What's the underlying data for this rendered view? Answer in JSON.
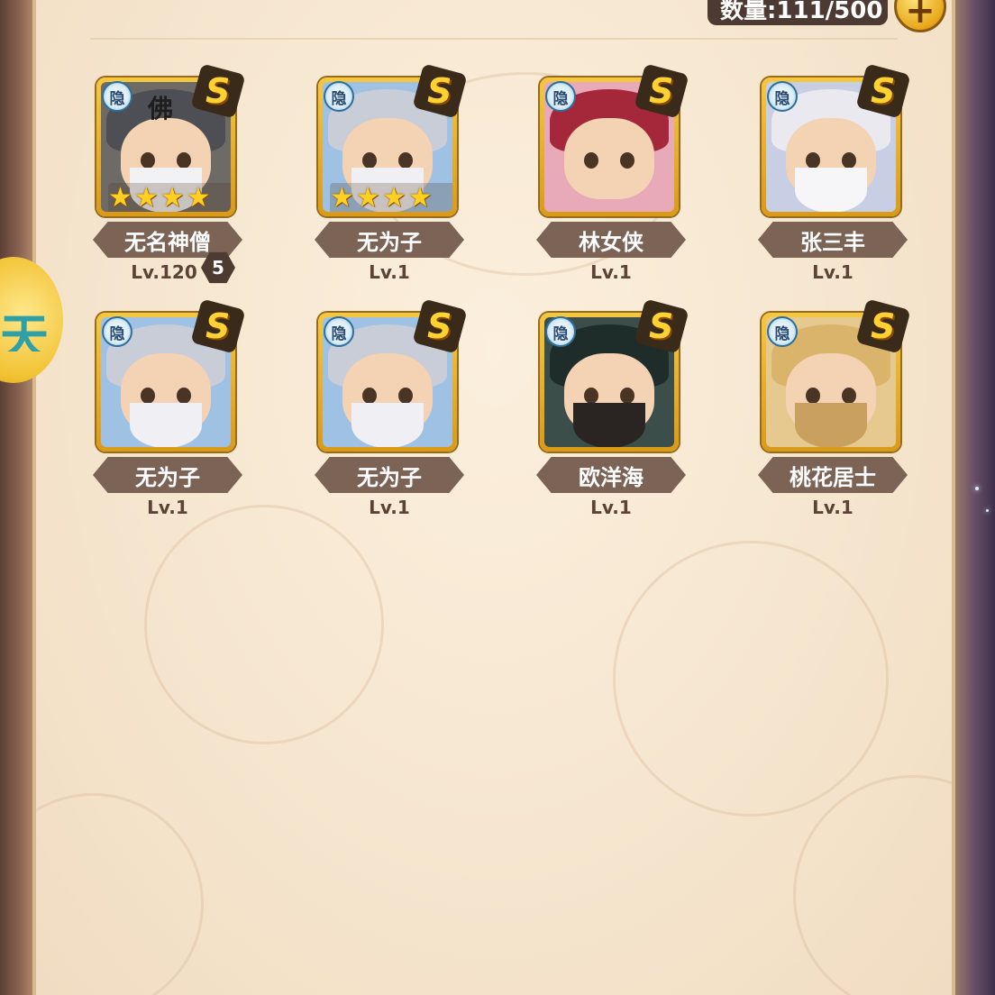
{
  "header": {
    "count_label": "数量:111/500",
    "add_label": "+"
  },
  "side_tab": {
    "glyph": "天"
  },
  "heroes": [
    {
      "name": "无名神僧",
      "level": "Lv.120",
      "stars": "★★★★",
      "rank": "S",
      "tag": "隐",
      "hat_text": "佛",
      "level_badge": "5",
      "colors": {
        "bg": "#6e6a66",
        "hair": "#4e4f55",
        "beard": "#f2f2f4"
      }
    },
    {
      "name": "无为子",
      "level": "Lv.1",
      "stars": "★★★★",
      "rank": "S",
      "tag": "隐",
      "colors": {
        "bg": "#9fc2e4",
        "hair": "#c9cdd8",
        "beard": "#f0f0f4"
      }
    },
    {
      "name": "林女侠",
      "level": "Lv.1",
      "rank": "S",
      "tag": "隐",
      "colors": {
        "bg": "#e8a9b8",
        "hair": "#a5283a",
        "beard": ""
      }
    },
    {
      "name": "张三丰",
      "level": "Lv.1",
      "rank": "S",
      "tag": "隐",
      "colors": {
        "bg": "#c8cfe4",
        "hair": "#e9e9ef",
        "beard": "#f6f6f8"
      }
    },
    {
      "name": "无为子",
      "level": "Lv.1",
      "rank": "S",
      "tag": "隐",
      "colors": {
        "bg": "#9fc2e4",
        "hair": "#c9cdd8",
        "beard": "#f0f0f4"
      }
    },
    {
      "name": "无为子",
      "level": "Lv.1",
      "rank": "S",
      "tag": "隐",
      "colors": {
        "bg": "#9fc2e4",
        "hair": "#c9cdd8",
        "beard": "#f0f0f4"
      }
    },
    {
      "name": "欧洋海",
      "level": "Lv.1",
      "rank": "S",
      "tag": "隐",
      "colors": {
        "bg": "#3c4e4a",
        "hair": "#1f2d2a",
        "beard": "#2a2522"
      }
    },
    {
      "name": "桃花居士",
      "level": "Lv.1",
      "rank": "S",
      "tag": "隐",
      "colors": {
        "bg": "#e6c98e",
        "hair": "#d9b46a",
        "beard": "#c9a060"
      }
    }
  ]
}
